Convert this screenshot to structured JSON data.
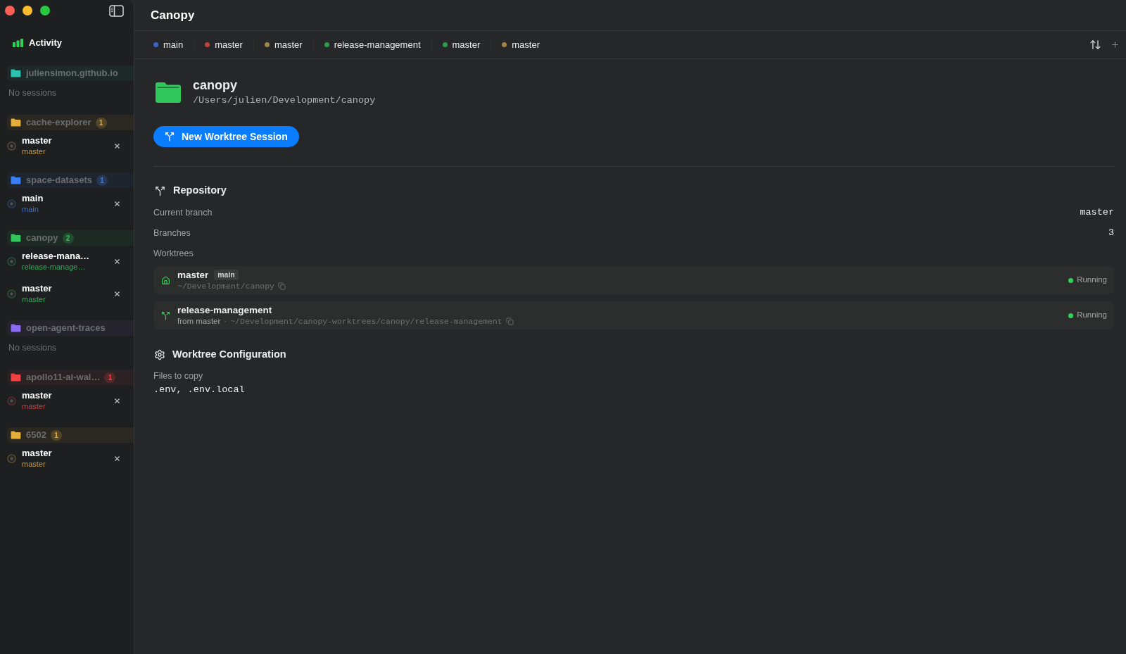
{
  "sidebar": {
    "activity": "Activity",
    "projects": [
      {
        "name": "juliensimon.github.io",
        "color": "#2dc2b0",
        "empty_note": "No sessions"
      },
      {
        "name": "cache-explorer",
        "color": "#e3ae3c",
        "count": "1",
        "sessions": [
          {
            "title": "master",
            "branch": "master"
          }
        ]
      },
      {
        "name": "space-datasets",
        "color": "#3a7ff2",
        "count": "1",
        "sessions": [
          {
            "title": "main",
            "branch": "main"
          }
        ]
      },
      {
        "name": "canopy",
        "color": "#31c55a",
        "count": "2",
        "sessions": [
          {
            "title": "release-mana…",
            "branch": "release-manage…"
          },
          {
            "title": "master",
            "branch": "master"
          }
        ]
      },
      {
        "name": "open-agent-traces",
        "color": "#8a6cf2",
        "empty_note": "No sessions"
      },
      {
        "name": "apollo11-ai-wal…",
        "color": "#ee4343",
        "count": "1",
        "sessions": [
          {
            "title": "master",
            "branch": "master"
          }
        ]
      },
      {
        "name": "6502",
        "color": "#e3ae3c",
        "count": "1",
        "sessions": [
          {
            "title": "master",
            "branch": "master"
          }
        ]
      }
    ]
  },
  "window": {
    "title": "Canopy"
  },
  "tabs": [
    {
      "label": "main",
      "color": "#3f64c6"
    },
    {
      "label": "master",
      "color": "#c2423f"
    },
    {
      "label": "master",
      "color": "#a08448"
    },
    {
      "label": "release-management",
      "color": "#2e9c4a"
    },
    {
      "label": "master",
      "color": "#2e9c4a"
    },
    {
      "label": "master",
      "color": "#a08448"
    }
  ],
  "project": {
    "name": "canopy",
    "path": "/Users/julien/Development/canopy",
    "new_button": "New Worktree Session"
  },
  "repository": {
    "title": "Repository",
    "rows": [
      {
        "label": "Current branch",
        "value": "master"
      },
      {
        "label": "Branches",
        "value": "3"
      }
    ],
    "worktrees_label": "Worktrees",
    "worktrees": [
      {
        "kind": "main",
        "name": "master",
        "badge": "main",
        "path": "~/Development/canopy",
        "status": "Running",
        "running": true
      },
      {
        "kind": "branch",
        "name": "release-management",
        "from": "from master",
        "separator": "·",
        "path": "~/Development/canopy-worktrees/canopy/release-management",
        "status": "Running",
        "running": true
      }
    ]
  },
  "configuration": {
    "title": "Worktree Configuration",
    "label": "Files to copy",
    "value": ".env, .env.local"
  }
}
